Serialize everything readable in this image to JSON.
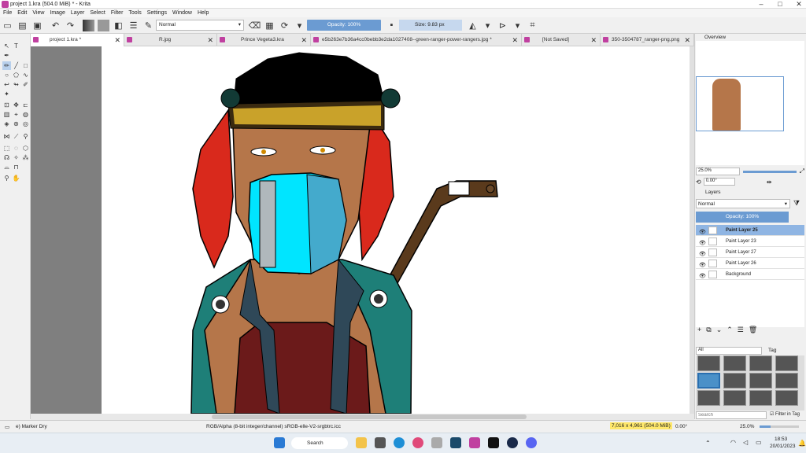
{
  "window": {
    "title": "project 1.kra (504.0 MiB)  * - Krita"
  },
  "menu": [
    "File",
    "Edit",
    "View",
    "Image",
    "Layer",
    "Select",
    "Filter",
    "Tools",
    "Settings",
    "Window",
    "Help"
  ],
  "toolbar": {
    "blend_mode": "Normal",
    "opacity": "Opacity: 100%",
    "size": "Size: 9.83 px"
  },
  "tabs": [
    {
      "label": "project 1.kra *",
      "active": true
    },
    {
      "label": "R.jpg"
    },
    {
      "label": "Prince Vegeta3.kra"
    },
    {
      "label": "e5b263e7b36a4cc0bebb3e2da1027408--green-ranger-power-rangers.jpg *"
    },
    {
      "label": "[Not Saved]"
    },
    {
      "label": "350-3504787_ranger-png.png"
    }
  ],
  "overview": {
    "title": "Overview",
    "zoom": "25.0%",
    "rotation": "0.00°"
  },
  "layers": {
    "title": "Layers",
    "blend_mode": "Normal",
    "opacity": "Opacity:  100%",
    "items": [
      {
        "name": "Paint Layer 25",
        "selected": true
      },
      {
        "name": "Paint Layer 23"
      },
      {
        "name": "Paint Layer 27"
      },
      {
        "name": "Paint Layer 26"
      },
      {
        "name": "Background"
      }
    ]
  },
  "brush_presets": {
    "title": "Brush Presets",
    "filter": "All",
    "tag": "Tag",
    "search_placeholder": "Search",
    "filter_in_tag": "Filter in Tag"
  },
  "status": {
    "brush": "e) Marker Dry",
    "color_space": "RGB/Alpha (8-bit integer/channel)  sRGB-elle-V2-srgbtrc.icc",
    "dimensions": "7,016 x 4,961 (504.0 MiB)",
    "rotation": "0.00°",
    "zoom": "25.0%"
  },
  "taskbar": {
    "search": "Search",
    "time": "18:53",
    "date": "20/01/2023"
  },
  "colors": {
    "accent": "#6b9bd2",
    "selected_layer": "#8fb5e3",
    "canvas_bg": "#7f7f7f"
  }
}
